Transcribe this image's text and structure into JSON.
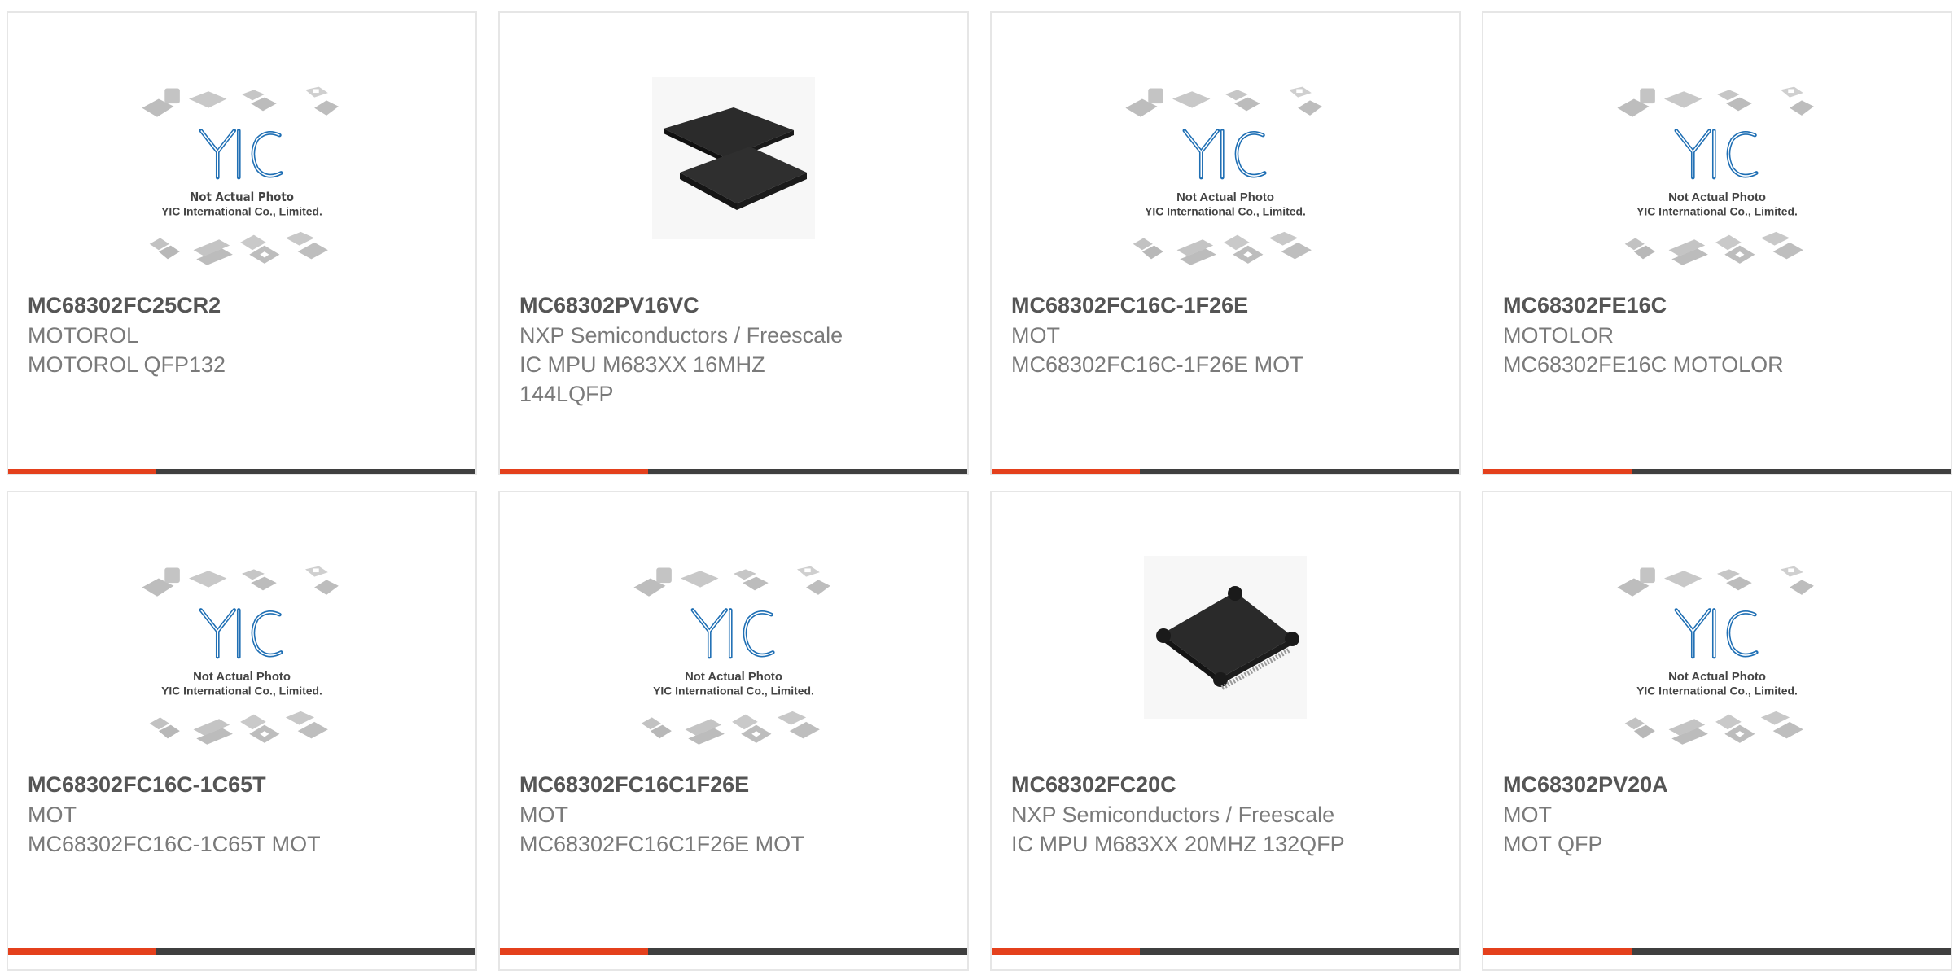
{
  "colors": {
    "accent": "#e4401c",
    "bar": "#3f3f3f",
    "logo_blue": "#1f6fb4"
  },
  "placeholder": {
    "logo_text": "YIC",
    "line1": "Not Actual Photo",
    "line2": "YIC International Co., Limited."
  },
  "cards": [
    {
      "part_number": "MC68302FC25CR2",
      "manufacturer": "MOTOROL",
      "description": "MOTOROL QFP132",
      "image": "yic-placeholder"
    },
    {
      "part_number": "MC68302PV16VC",
      "manufacturer": "NXP Semiconductors / Freescale",
      "description": "IC MPU M683XX 16MHZ 144LQFP",
      "image": "lqfp-chip-photo"
    },
    {
      "part_number": "MC68302FC16C-1F26E",
      "manufacturer": "MOT",
      "description": "MC68302FC16C-1F26E MOT",
      "image": "yic-placeholder"
    },
    {
      "part_number": "MC68302FE16C",
      "manufacturer": "MOTOLOR",
      "description": "MC68302FE16C MOTOLOR",
      "image": "yic-placeholder"
    },
    {
      "part_number": "MC68302FC16C-1C65T",
      "manufacturer": "MOT",
      "description": "MC68302FC16C-1C65T MOT",
      "image": "yic-placeholder"
    },
    {
      "part_number": "MC68302FC16C1F26E",
      "manufacturer": "MOT",
      "description": "MC68302FC16C1F26E MOT",
      "image": "yic-placeholder"
    },
    {
      "part_number": "MC68302FC20C",
      "manufacturer": "NXP Semiconductors / Freescale",
      "description": "IC MPU M683XX 20MHZ 132QFP",
      "image": "qfp-chip-photo"
    },
    {
      "part_number": "MC68302PV20A",
      "manufacturer": "MOT",
      "description": "MOT QFP",
      "image": "yic-placeholder"
    }
  ]
}
